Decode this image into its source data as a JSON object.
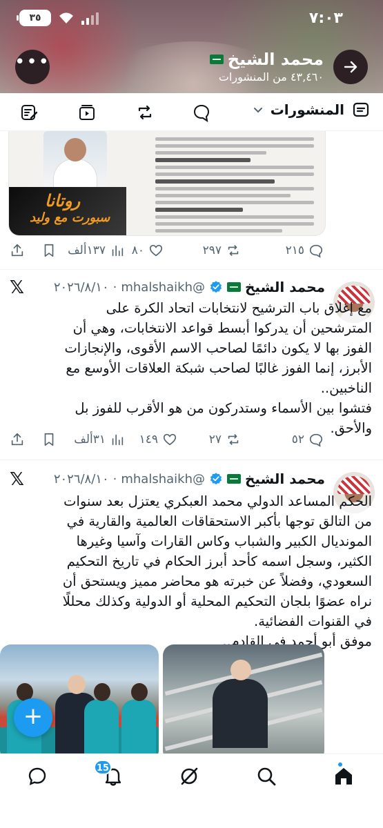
{
  "status_bar": {
    "time": "٧:٠٣",
    "battery": "٣٥"
  },
  "profile": {
    "name": "محمد الشيخ",
    "posts_count_label": "٤٣,٤٦٠ من المنشورات"
  },
  "tabs": {
    "posts_label": "المنشورات"
  },
  "post1": {
    "image_logo_line1": "روتانا",
    "image_logo_line2": "سبورت مع وليد",
    "stats": {
      "replies": "٢١٥",
      "reposts": "٢٩٧",
      "likes": "٨٠",
      "views": "١٣٧ألف"
    }
  },
  "post2": {
    "author": "محمد الشيخ",
    "handle": "@mhalshaikh",
    "date": "٢٠٢٦/٨/١٠",
    "text": "مع إغلاق باب الترشيح لانتخابات اتحاد الكرة على المترشحين أن يدركوا أبسط قواعد الانتخابات، وهي أن الفوز بها لا يكون دائمًا لصاحب الاسم الأقوى، والإنجازات الأبرز، إنما الفوز غالبًا لصاحب شبكة العلاقات الأوسع مع الناخبين..\nفتشوا بين الأسماء وستدركون من هو الأقرب للفوز بل والأحق.",
    "stats": {
      "replies": "٥٢",
      "reposts": "٢٧",
      "likes": "١٤٩",
      "views": "٣١ألف"
    }
  },
  "post3": {
    "author": "محمد الشيخ",
    "handle": "@mhalshaikh",
    "date": "٢٠٢٦/٨/١٠",
    "text": "الحكم المساعد الدولي محمد العبكري يعتزل بعد سنوات من التالق توجها بأكبر الاستحقاقات العالمية والقارية في المونديال الكبير والشباب وكاس القارات وآسيا وغيرها الكثير، وسجل اسمه كأحد أبرز الحكام في تاريخ التحكيم السعودي، وفضلاً عن خبرته هو محاضر مميز ويستحق أن نراه عضوًا بلجان التحكيم المحلية أو الدولية وكذلك محللًا في القنوات الفضائية.\nموفق أبو أحمد في القادم.."
  },
  "bottom_nav": {
    "notifications_badge": "15"
  },
  "colors": {
    "accent": "#1d9bf0",
    "verified": "#1d9bf0",
    "text_secondary": "#536471",
    "divider": "#eff3f4"
  },
  "icons": [
    "back-arrow-icon",
    "more-icon",
    "posts-tab-icon",
    "chevron-down-icon",
    "reply-icon",
    "repost-icon",
    "like-icon",
    "views-icon",
    "bookmark-icon",
    "share-icon",
    "verified-icon",
    "x-logo-icon",
    "compose-icon",
    "home-icon",
    "search-icon",
    "grok-icon",
    "notifications-icon",
    "messages-icon"
  ]
}
